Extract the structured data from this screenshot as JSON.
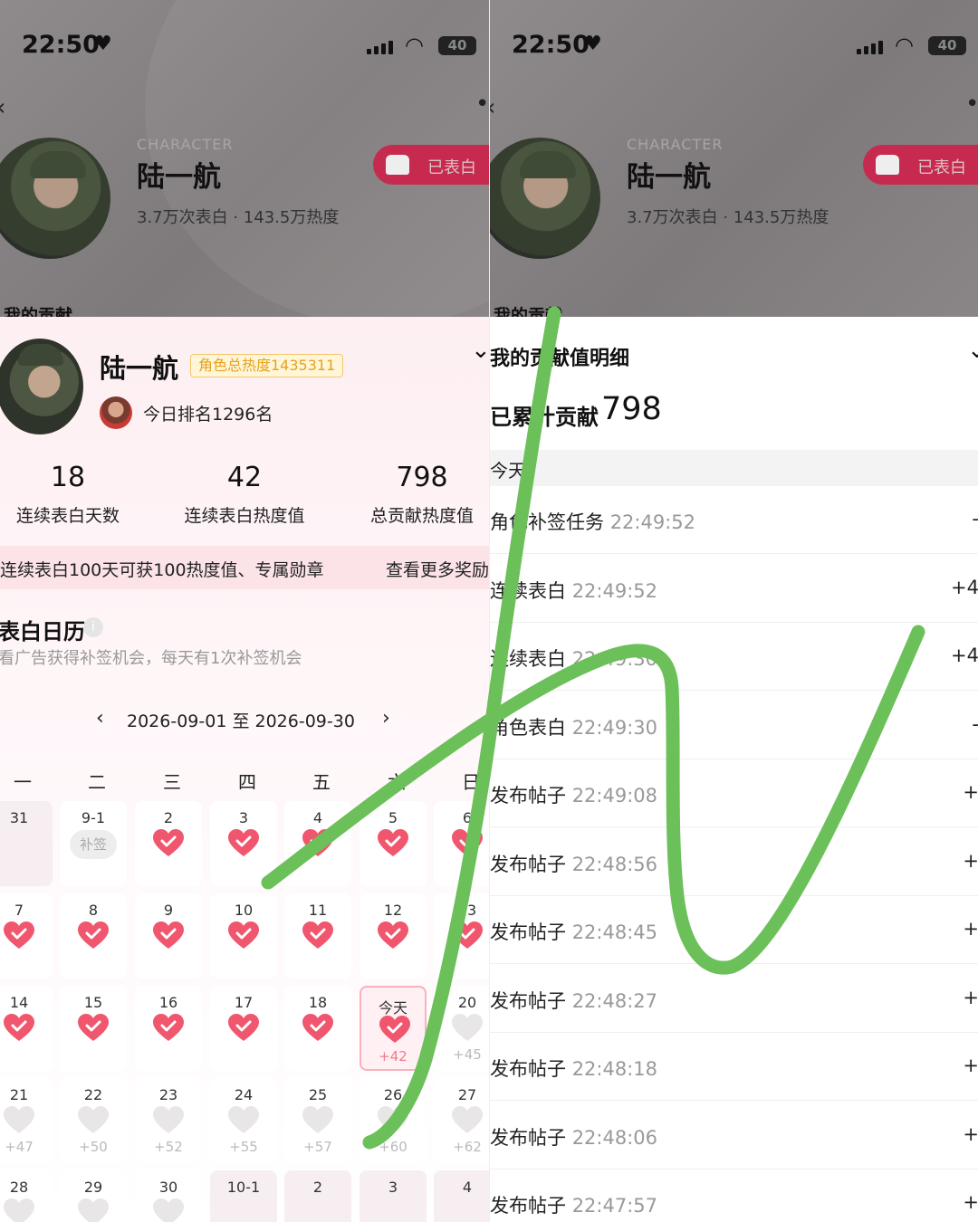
{
  "status": {
    "time": "22:50",
    "battery": "40"
  },
  "character": {
    "label": "CHARACTER",
    "name": "陆一航",
    "stats": "3.7万次表白 · 143.5万热度",
    "confessed_button": "已表白",
    "contribution_peek": "我的贡献"
  },
  "sheet": {
    "name": "陆一航",
    "heat_badge": "角色总热度1435311",
    "rank": "今日排名1296名",
    "stats": [
      {
        "value": "18",
        "label": "连续表白天数"
      },
      {
        "value": "42",
        "label": "连续表白热度值"
      },
      {
        "value": "798",
        "label": "总贡献热度值"
      }
    ],
    "reward_text": "连续表白100天可获100热度值、专属勋章",
    "reward_link": "查看更多奖励",
    "calendar_title": "表白日历",
    "calendar_subtitle": "看广告获得补签机会，每天有1次补签机会",
    "month_range": "2026-09-01 至 2026-09-30",
    "weekdays": [
      "一",
      "二",
      "三",
      "四",
      "五",
      "六",
      "日"
    ],
    "rows": [
      [
        {
          "d": "31",
          "state": "faded"
        },
        {
          "d": "9-1",
          "state": "makeup",
          "label": "补签"
        },
        {
          "d": "2",
          "state": "done"
        },
        {
          "d": "3",
          "state": "done"
        },
        {
          "d": "4",
          "state": "done"
        },
        {
          "d": "5",
          "state": "done"
        },
        {
          "d": "6",
          "state": "done"
        }
      ],
      [
        {
          "d": "7",
          "state": "done"
        },
        {
          "d": "8",
          "state": "done"
        },
        {
          "d": "9",
          "state": "done"
        },
        {
          "d": "10",
          "state": "done"
        },
        {
          "d": "11",
          "state": "done"
        },
        {
          "d": "12",
          "state": "done"
        },
        {
          "d": "13",
          "state": "done"
        }
      ],
      [
        {
          "d": "14",
          "state": "done"
        },
        {
          "d": "15",
          "state": "done"
        },
        {
          "d": "16",
          "state": "done"
        },
        {
          "d": "17",
          "state": "done"
        },
        {
          "d": "18",
          "state": "done"
        },
        {
          "d": "今天",
          "state": "today",
          "plus": "+42"
        },
        {
          "d": "20",
          "state": "future",
          "plus": "+45"
        }
      ],
      [
        {
          "d": "21",
          "state": "future",
          "plus": "+47"
        },
        {
          "d": "22",
          "state": "future",
          "plus": "+50"
        },
        {
          "d": "23",
          "state": "future",
          "plus": "+52"
        },
        {
          "d": "24",
          "state": "future",
          "plus": "+55"
        },
        {
          "d": "25",
          "state": "future",
          "plus": "+57"
        },
        {
          "d": "26",
          "state": "future",
          "plus": "+60"
        },
        {
          "d": "27",
          "state": "future",
          "plus": "+62"
        }
      ],
      [
        {
          "d": "28",
          "state": "future"
        },
        {
          "d": "29",
          "state": "future"
        },
        {
          "d": "30",
          "state": "future"
        },
        {
          "d": "10-1",
          "state": "faded"
        },
        {
          "d": "2",
          "state": "faded"
        },
        {
          "d": "3",
          "state": "faded"
        },
        {
          "d": "4",
          "state": "faded"
        }
      ]
    ]
  },
  "detail": {
    "title": "我的贡献值明细",
    "total_label": "已累计贡献",
    "total_value": "798",
    "section_today": "今天",
    "items": [
      {
        "name": "角色补签任务",
        "time": "22:49:52",
        "value": "-"
      },
      {
        "name": "连续表白",
        "time": "22:49:52",
        "value": "+4"
      },
      {
        "name": "连续表白",
        "time": "22:49:30",
        "value": "+4"
      },
      {
        "name": "角色表白",
        "time": "22:49:30",
        "value": "-"
      },
      {
        "name": "发布帖子",
        "time": "22:49:08",
        "value": "+"
      },
      {
        "name": "发布帖子",
        "time": "22:48:56",
        "value": "+"
      },
      {
        "name": "发布帖子",
        "time": "22:48:45",
        "value": "+"
      },
      {
        "name": "发布帖子",
        "time": "22:48:27",
        "value": "+"
      },
      {
        "name": "发布帖子",
        "time": "22:48:18",
        "value": "+"
      },
      {
        "name": "发布帖子",
        "time": "22:48:06",
        "value": "+"
      },
      {
        "name": "发布帖子",
        "time": "22:47:57",
        "value": "+"
      }
    ]
  },
  "colors": {
    "accent": "#f0566d",
    "heart_empty": "#e9e6e7",
    "scribble": "#6cc05a"
  }
}
